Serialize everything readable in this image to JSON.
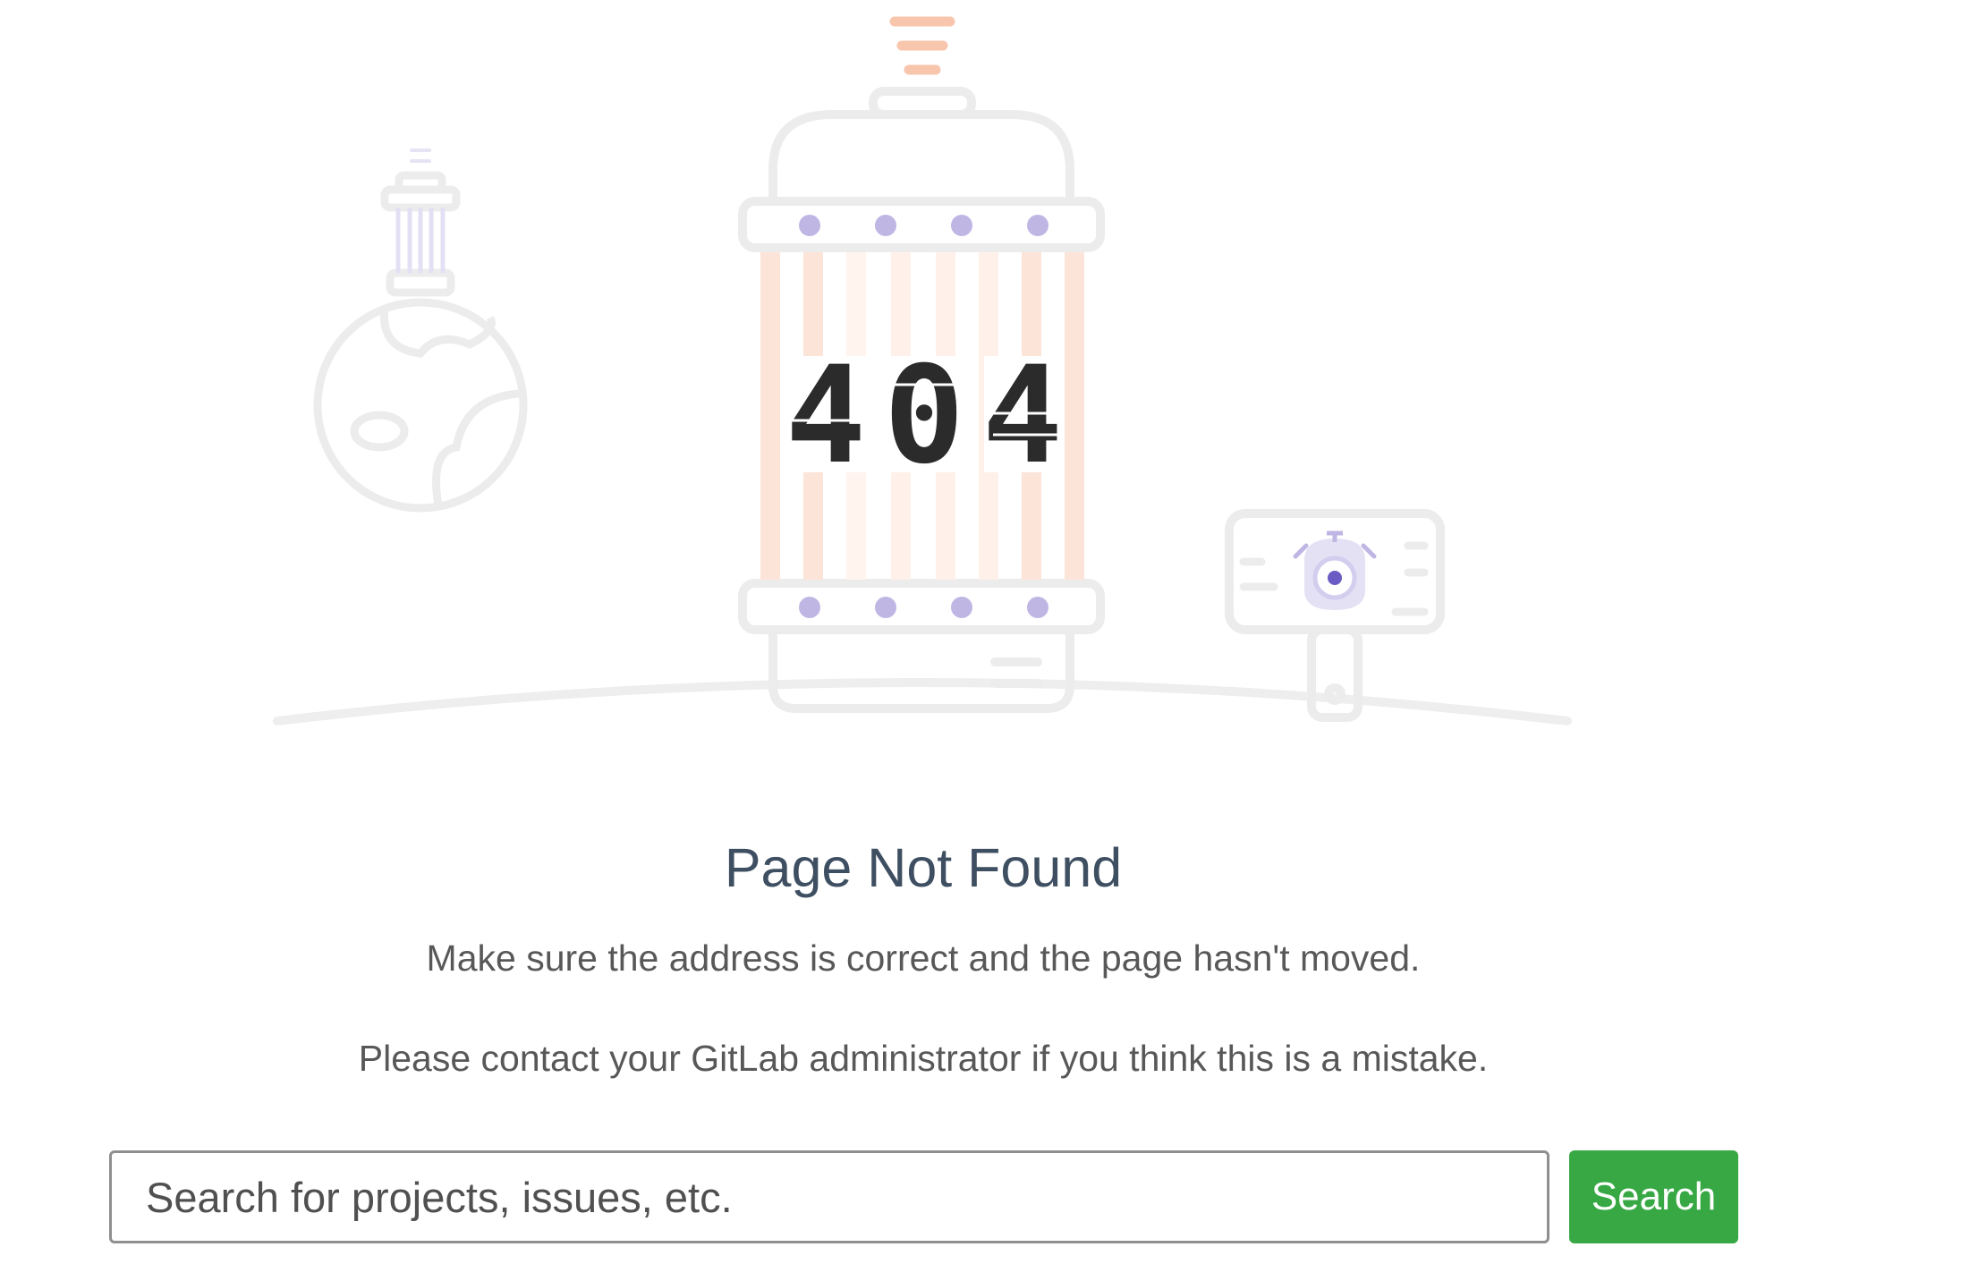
{
  "illustration": {
    "code_digits": [
      "4",
      "0",
      "4"
    ]
  },
  "error": {
    "title": "Page Not Found",
    "message_line1": "Make sure the address is correct and the page hasn't moved.",
    "message_line2": "Please contact your GitLab administrator if you think this is a mistake."
  },
  "search": {
    "placeholder": "Search for projects, issues, etc.",
    "value": "",
    "button_label": "Search"
  },
  "colors": {
    "title": "#3e4f62",
    "text": "#585858",
    "button": "#37a843",
    "illustration_outline": "#ececec",
    "illustration_accent": "#f9c8ae",
    "illustration_dots": "#c0b6e4"
  }
}
